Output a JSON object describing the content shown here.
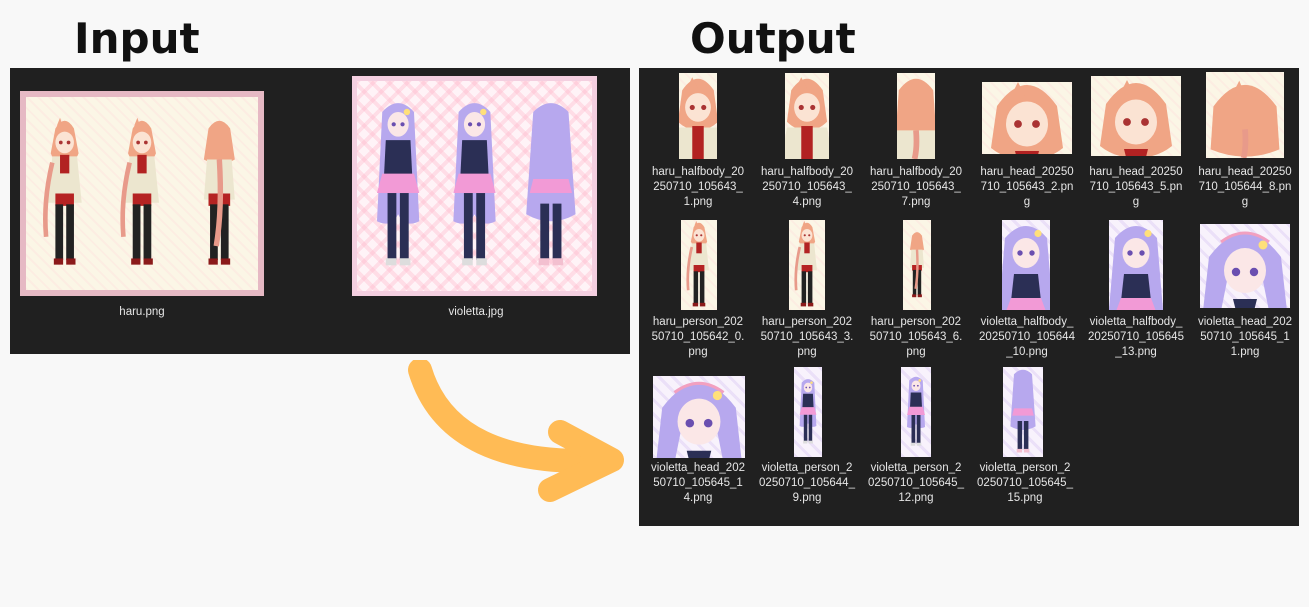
{
  "headings": {
    "input": "Input",
    "output": "Output"
  },
  "input_files": [
    {
      "name": "haru.png",
      "character": "haru"
    },
    {
      "name": "violetta.jpg",
      "character": "violetta"
    }
  ],
  "output_files": [
    {
      "name": "haru_halfbody_20250710_105643_1.png",
      "character": "haru",
      "kind": "halfbody"
    },
    {
      "name": "haru_halfbody_20250710_105643_4.png",
      "character": "haru",
      "kind": "halfbody"
    },
    {
      "name": "haru_halfbody_20250710_105643_7.png",
      "character": "haru",
      "kind": "halfbody-back"
    },
    {
      "name": "haru_head_20250710_105643_2.png",
      "character": "haru",
      "kind": "head"
    },
    {
      "name": "haru_head_20250710_105643_5.png",
      "character": "haru",
      "kind": "head"
    },
    {
      "name": "haru_head_20250710_105644_8.png",
      "character": "haru",
      "kind": "head-back"
    },
    {
      "name": "haru_person_20250710_105642_0.png",
      "character": "haru",
      "kind": "person"
    },
    {
      "name": "haru_person_20250710_105643_3.png",
      "character": "haru",
      "kind": "person"
    },
    {
      "name": "haru_person_20250710_105643_6.png",
      "character": "haru",
      "kind": "person-back"
    },
    {
      "name": "violetta_halfbody_20250710_105644_10.png",
      "character": "violetta",
      "kind": "halfbody"
    },
    {
      "name": "violetta_halfbody_20250710_105645_13.png",
      "character": "violetta",
      "kind": "halfbody"
    },
    {
      "name": "violetta_head_20250710_105645_11.png",
      "character": "violetta",
      "kind": "head"
    },
    {
      "name": "violetta_head_20250710_105645_14.png",
      "character": "violetta",
      "kind": "head"
    },
    {
      "name": "violetta_person_20250710_105644_9.png",
      "character": "violetta",
      "kind": "person"
    },
    {
      "name": "violetta_person_20250710_105645_12.png",
      "character": "violetta",
      "kind": "person"
    },
    {
      "name": "violetta_person_20250710_105645_15.png",
      "character": "violetta",
      "kind": "person-back"
    }
  ],
  "colors": {
    "page_background": "#f8f8f8",
    "panel_background": "#202020",
    "caption_text": "#e6e6e6",
    "arrow": "#ffbb55",
    "haru_hair": "#f0a585",
    "haru_coat": "#ece6cf",
    "violetta_hair": "#b7a8ee",
    "violetta_skirt": "#f29ad6"
  },
  "icons": {
    "arrow": "curved-arrow-icon"
  }
}
